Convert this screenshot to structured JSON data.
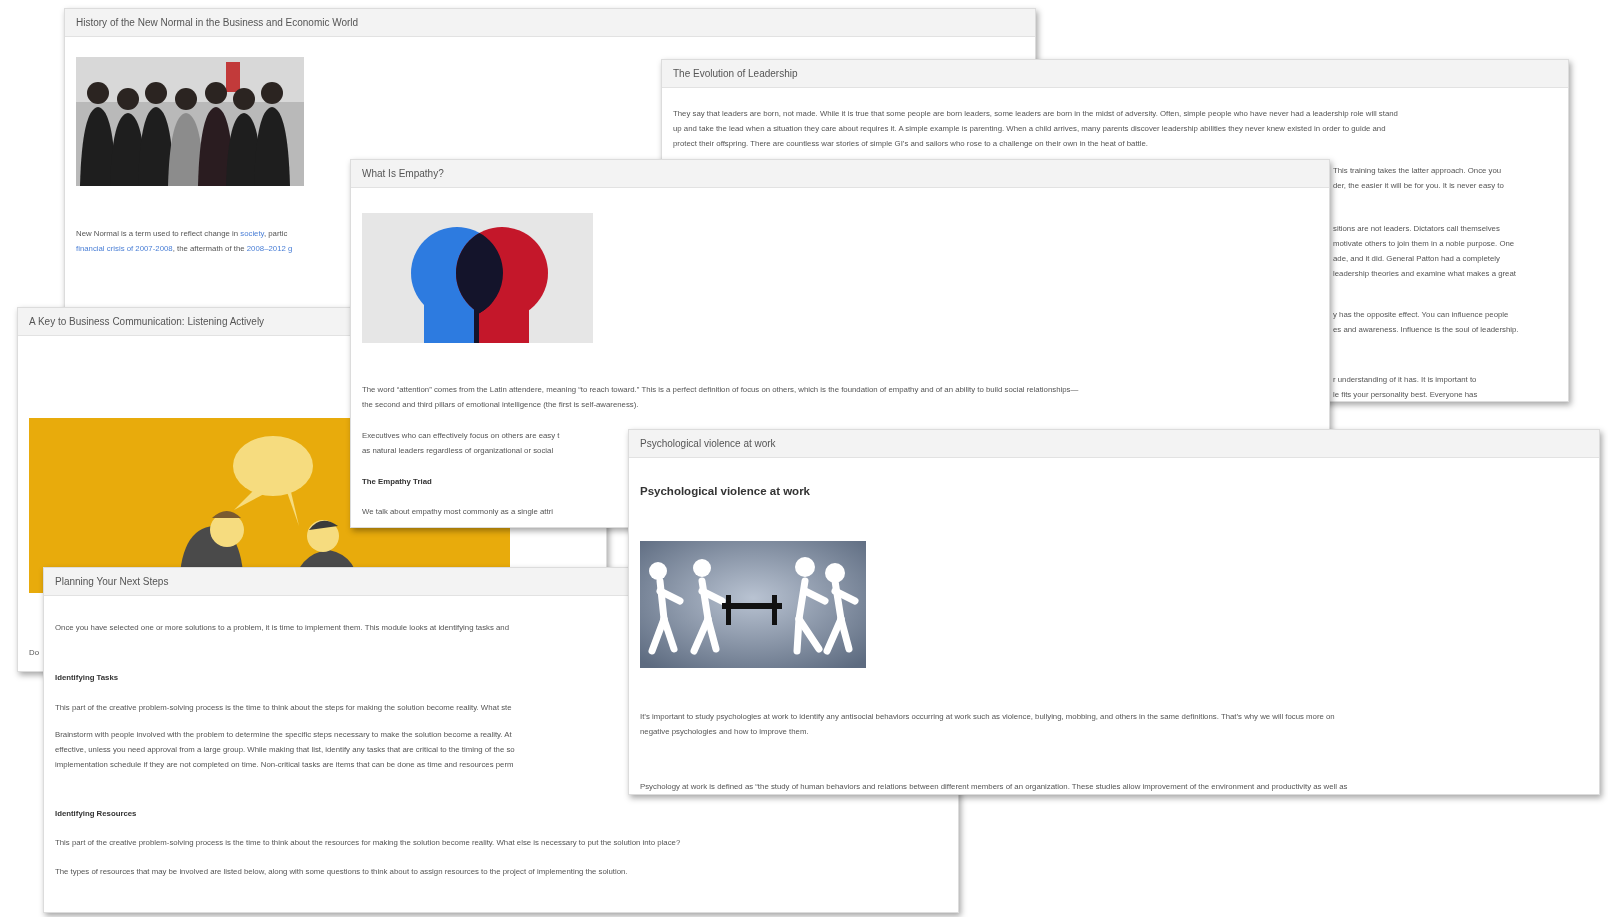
{
  "cards": [
    {
      "title": "History of the New Normal in the Business and Economic World",
      "blocks": [
        {
          "kind": "picture"
        },
        {
          "kind": "linked_paragraph",
          "lines": [
            [
              {
                "text": "New Normal is a term used to reflect change in ",
                "kind": "plain"
              },
              {
                "text": "society",
                "kind": "link"
              },
              {
                "text": ", partic",
                "kind": "plain"
              }
            ],
            [
              {
                "text": "financial crisis of 2007-2008",
                "kind": "link"
              },
              {
                "text": ", the aftermath of the ",
                "kind": "plain"
              },
              {
                "text": "2008–2012 g",
                "kind": "link"
              }
            ]
          ]
        }
      ]
    },
    {
      "title": "The Evolution of Leadership",
      "blocks": [
        {
          "kind": "paragraph",
          "lines": [
            "They say that leaders are born, not made. While it is true that some people are born leaders, some leaders are born in the midst of adversity. Often, simple people who have never had a leadership role will stand",
            "up and take the lead when a situation they care about requires it. A simple example is parenting. When a child arrives, many parents discover leadership abilities they never knew existed in order to guide and",
            "protect their offspring. There are countless war stories of simple GI’s and sailors who rose to a challenge on their own in the heat of battle."
          ]
        },
        {
          "kind": "fragment",
          "lines": [
            "This training takes the latter approach. Once you",
            "der, the easier it will be for you. It is never easy to"
          ]
        },
        {
          "kind": "fragment",
          "lines": [
            "sitions are not leaders. Dictators call themselves",
            "motivate others to join them in a noble purpose. One",
            "ade, and it did. General Patton had a completely",
            "leadership theories and examine what makes a great"
          ]
        },
        {
          "kind": "fragment",
          "lines": [
            "y has the opposite effect. You can influence people",
            "es and awareness. Influence is the soul of leadership."
          ]
        },
        {
          "kind": "fragment",
          "lines": [
            "r understanding of it has. It is important to",
            "le fits your personality best. Everyone has"
          ]
        }
      ]
    },
    {
      "title": "A Key to Business Communication: Listening Actively",
      "blocks": [
        {
          "kind": "picture"
        },
        {
          "kind": "paragraph",
          "lines": [
            "Do"
          ]
        }
      ]
    },
    {
      "title": "What Is Empathy?",
      "blocks": [
        {
          "kind": "picture"
        },
        {
          "kind": "paragraph",
          "lines": [
            "The word “attention” comes from the Latin attendere, meaning “to reach toward.” This is a perfect definition of focus on others, which is the foundation of empathy and of an ability to build social relationships—",
            "the second and third pillars of emotional intelligence (the first is self-awareness)."
          ]
        },
        {
          "kind": "paragraph",
          "lines": [
            "Executives who can effectively focus on others are easy t",
            "as natural leaders regardless of organizational or social"
          ]
        },
        {
          "kind": "heading",
          "lines": [
            "The Empathy Triad"
          ]
        },
        {
          "kind": "paragraph",
          "lines": [
            "We talk about empathy most commonly as a single attri"
          ]
        }
      ]
    },
    {
      "title": "Planning Your Next Steps",
      "blocks": [
        {
          "kind": "paragraph",
          "lines": [
            "Once you have selected one or more solutions to a problem, it is time to implement them. This module looks at identifying tasks and"
          ]
        },
        {
          "kind": "heading",
          "lines": [
            "Identifying Tasks"
          ]
        },
        {
          "kind": "paragraph",
          "lines": [
            "This part of the creative problem-solving process is the time to think about the steps for making the solution become reality. What ste"
          ]
        },
        {
          "kind": "paragraph",
          "lines": [
            "Brainstorm with people involved with the problem to determine the specific steps necessary to make the solution become a reality. At",
            "effective, unless you need approval from a large group. While making that list, identify any tasks that are critical to the timing of the so",
            "implementation schedule if they are not completed on time. Non-critical tasks are items that can be done as time and resources perm"
          ]
        },
        {
          "kind": "heading",
          "lines": [
            "Identifying Resources"
          ]
        },
        {
          "kind": "paragraph",
          "lines": [
            "This part of the creative problem-solving process is the time to think about the resources for making the solution become reality. What else is necessary to put the solution into place?"
          ]
        },
        {
          "kind": "paragraph",
          "lines": [
            "The types of resources that may be involved are listed below, along with some questions to think about to assign resources to the project of implementing the solution."
          ]
        }
      ]
    },
    {
      "title": "Psychological violence at work",
      "blocks": [
        {
          "kind": "title",
          "lines": [
            "Psychological violence at work"
          ]
        },
        {
          "kind": "picture"
        },
        {
          "kind": "paragraph",
          "lines": [
            "It’s important to study psychologies at work to identify any antisocial behaviors occurring at work such as violence, bullying, mobbing, and others in the same definitions. That’s why we will focus more on",
            "negative psychologies and how to improve them."
          ]
        },
        {
          "kind": "paragraph",
          "lines": [
            "Psychology at work is defined as “the study of human behaviors and relations between different members of an organization. These studies allow improvement of the environment and productivity as well as"
          ]
        }
      ]
    }
  ]
}
